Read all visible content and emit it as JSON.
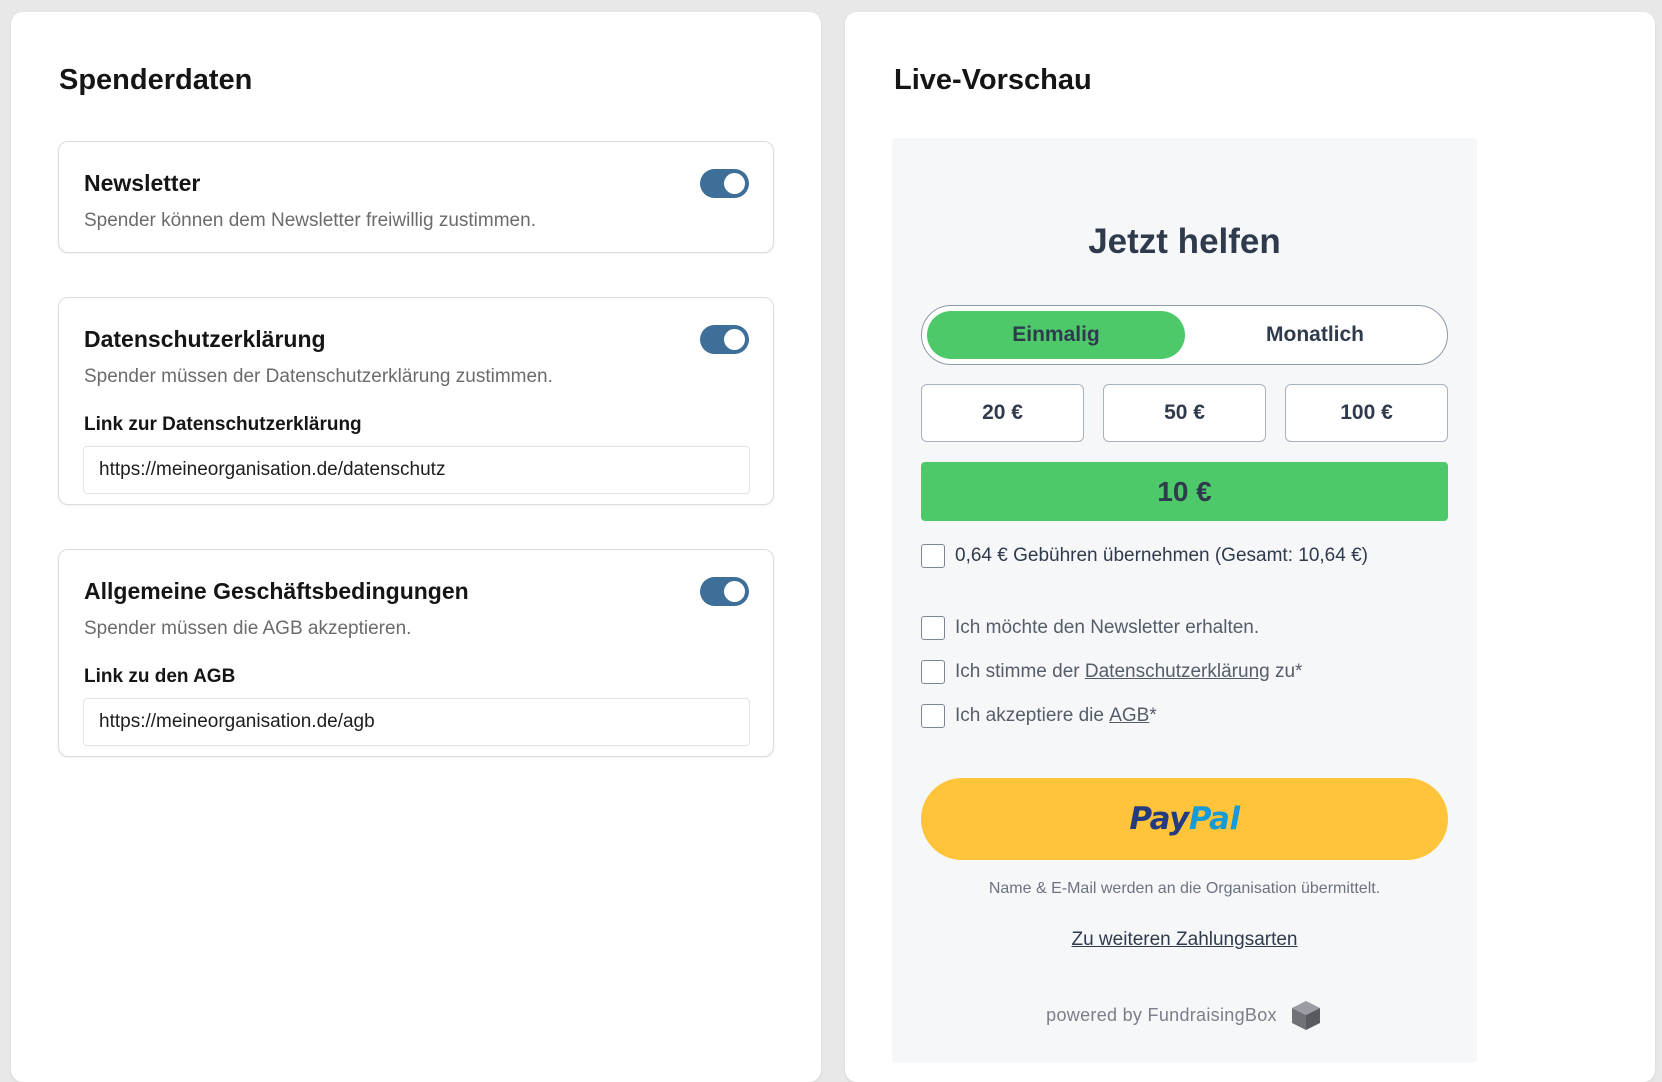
{
  "left_panel": {
    "title": "Spenderdaten",
    "cards": [
      {
        "title": "Newsletter",
        "description": "Spender können dem Newsletter freiwillig zustimmen.",
        "enabled": true
      },
      {
        "title": "Datenschutzerklärung",
        "description": "Spender müssen der Datenschutzerklärung zustimmen.",
        "enabled": true,
        "field_label": "Link zur Datenschutzerklärung",
        "field_value": "https://meineorganisation.de/datenschutz"
      },
      {
        "title": "Allgemeine Geschäftsbedingungen",
        "description": "Spender müssen die AGB akzeptieren.",
        "enabled": true,
        "field_label": "Link zu den AGB",
        "field_value": "https://meineorganisation.de/agb"
      }
    ]
  },
  "right_panel": {
    "title": "Live-Vorschau",
    "form": {
      "heading": "Jetzt helfen",
      "frequency": {
        "options": [
          "Einmalig",
          "Monatlich"
        ],
        "selected": "Einmalig"
      },
      "amounts": [
        "20 €",
        "50 €",
        "100 €"
      ],
      "custom_amount": "10 €",
      "fee_checkbox": "0,64 € Gebühren übernehmen (Gesamt: 10,64 €)",
      "consent": {
        "newsletter": "Ich möchte den Newsletter erhalten.",
        "privacy_prefix": "Ich stimme der ",
        "privacy_link": "Datenschutzerklärung",
        "privacy_suffix": " zu*",
        "terms_prefix": "Ich akzeptiere die ",
        "terms_link": "AGB",
        "terms_suffix": "*"
      },
      "paypal": {
        "part1": "Pay",
        "part2": "Pal"
      },
      "info_text": "Name & E-Mail werden an die Organisation übermittelt.",
      "more_payment_link": "Zu weiteren Zahlungsarten",
      "powered_by": "powered by FundraisingBox"
    }
  },
  "colors": {
    "toggle_on": "#3d6f99",
    "accent_green": "#4ec96a",
    "paypal_yellow": "#ffc439",
    "paypal_dark_blue": "#253b80",
    "paypal_light_blue": "#179bd7"
  },
  "icons": {
    "powered_by_logo": "cube-icon"
  }
}
